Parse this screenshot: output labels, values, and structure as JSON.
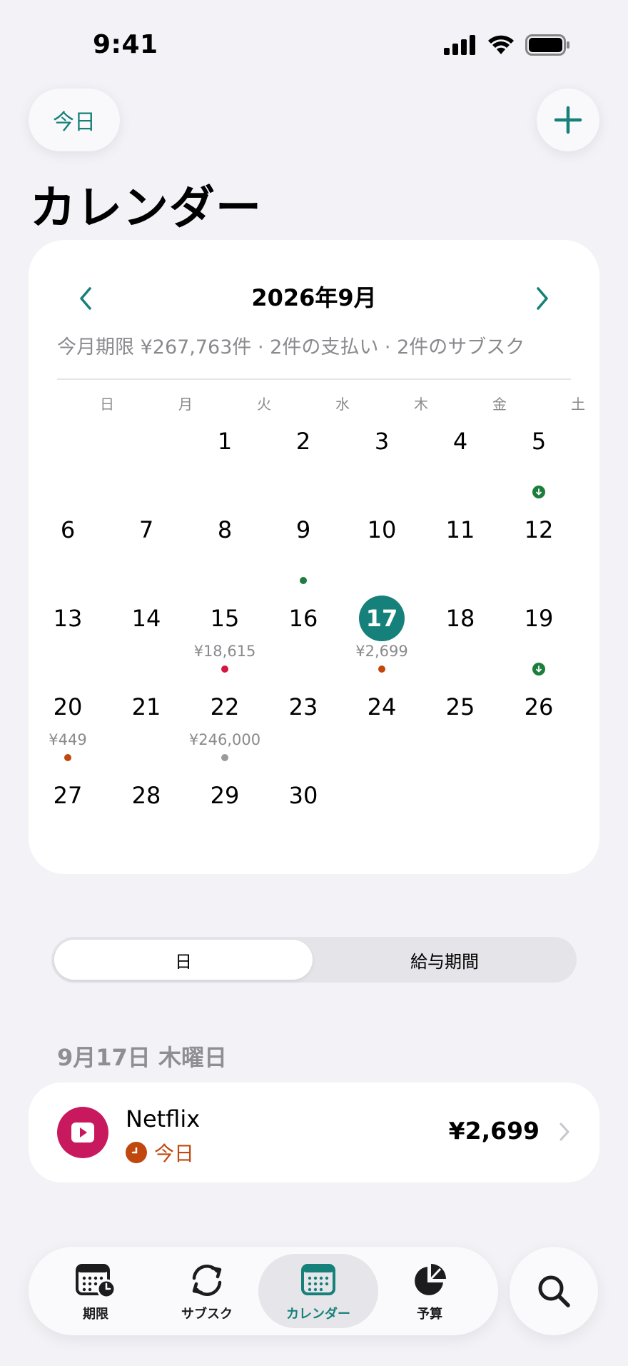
{
  "status_bar": {
    "time": "9:41"
  },
  "header": {
    "today_label": "今日",
    "title": "カレンダー"
  },
  "calendar": {
    "month_label": "2026年9月",
    "summary": "今月期限 ¥267,763件 · 2件の支払い · 2件のサブスク",
    "weekdays": [
      "日",
      "月",
      "火",
      "水",
      "木",
      "金",
      "土"
    ],
    "days": [
      {
        "day": "1",
        "col": 2,
        "row": 0
      },
      {
        "day": "2",
        "col": 3,
        "row": 0
      },
      {
        "day": "3",
        "col": 4,
        "row": 0
      },
      {
        "day": "4",
        "col": 5,
        "row": 0
      },
      {
        "day": "5",
        "col": 6,
        "row": 0,
        "marker": "income"
      },
      {
        "day": "6",
        "col": 0,
        "row": 1
      },
      {
        "day": "7",
        "col": 1,
        "row": 1
      },
      {
        "day": "8",
        "col": 2,
        "row": 1
      },
      {
        "day": "9",
        "col": 3,
        "row": 1,
        "marker": "dot",
        "dot_color": "#1d7d3c"
      },
      {
        "day": "10",
        "col": 4,
        "row": 1
      },
      {
        "day": "11",
        "col": 5,
        "row": 1
      },
      {
        "day": "12",
        "col": 6,
        "row": 1
      },
      {
        "day": "13",
        "col": 0,
        "row": 2
      },
      {
        "day": "14",
        "col": 1,
        "row": 2
      },
      {
        "day": "15",
        "col": 2,
        "row": 2,
        "amount": "¥18,615",
        "marker": "dot",
        "dot_color": "#d4173f"
      },
      {
        "day": "16",
        "col": 3,
        "row": 2
      },
      {
        "day": "17",
        "col": 4,
        "row": 2,
        "amount": "¥2,699",
        "marker": "dot",
        "dot_color": "#c0470e",
        "selected": true
      },
      {
        "day": "18",
        "col": 5,
        "row": 2
      },
      {
        "day": "19",
        "col": 6,
        "row": 2,
        "marker": "income"
      },
      {
        "day": "20",
        "col": 0,
        "row": 3,
        "amount": "¥449",
        "marker": "dot",
        "dot_color": "#c0470e"
      },
      {
        "day": "21",
        "col": 1,
        "row": 3
      },
      {
        "day": "22",
        "col": 2,
        "row": 3,
        "amount": "¥246,000",
        "marker": "dot",
        "dot_color": "#9a9a9e"
      },
      {
        "day": "23",
        "col": 3,
        "row": 3
      },
      {
        "day": "24",
        "col": 4,
        "row": 3
      },
      {
        "day": "25",
        "col": 5,
        "row": 3
      },
      {
        "day": "26",
        "col": 6,
        "row": 3
      },
      {
        "day": "27",
        "col": 0,
        "row": 4
      },
      {
        "day": "28",
        "col": 1,
        "row": 4
      },
      {
        "day": "29",
        "col": 2,
        "row": 4
      },
      {
        "day": "30",
        "col": 3,
        "row": 4
      }
    ]
  },
  "segment": {
    "day_label": "日",
    "pay_period_label": "給与期間"
  },
  "section": {
    "date_label": "9月17日 木曜日"
  },
  "item": {
    "name": "Netflix",
    "status": "今日",
    "amount": "¥2,699",
    "icon": "play-icon",
    "icon_color": "#c8195f",
    "status_color": "#c0470e"
  },
  "tabs": [
    {
      "label": "期限",
      "icon": "calendar-clock-icon"
    },
    {
      "label": "サブスク",
      "icon": "refresh-icon"
    },
    {
      "label": "カレンダー",
      "icon": "calendar-grid-icon",
      "active": true
    },
    {
      "label": "予算",
      "icon": "pie-chart-icon"
    }
  ],
  "colors": {
    "accent": "#16807a",
    "background": "#f2f2f7"
  }
}
